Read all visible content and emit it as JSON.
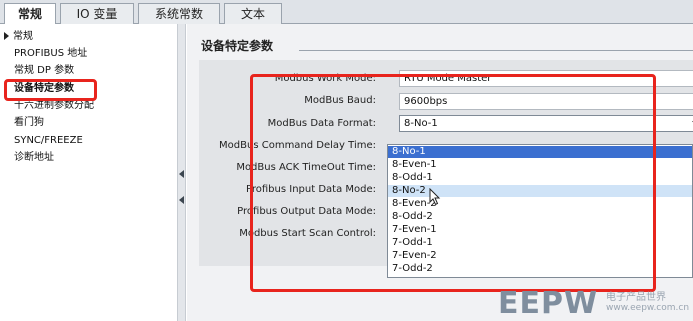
{
  "tabs": [
    {
      "label": "常规"
    },
    {
      "label": "IO 变量"
    },
    {
      "label": "系统常数"
    },
    {
      "label": "文本"
    }
  ],
  "nav": {
    "items": [
      {
        "label": "常规"
      },
      {
        "label": "PROFIBUS 地址"
      },
      {
        "label": "常规 DP 参数"
      },
      {
        "label": "设备特定参数"
      },
      {
        "label": "十六进制参数分配"
      },
      {
        "label": "看门狗"
      },
      {
        "label": "SYNC/FREEZE"
      },
      {
        "label": "诊断地址"
      }
    ]
  },
  "main": {
    "section_title": "设备特定参数",
    "fields": [
      {
        "label": "Modbus Work Mode:",
        "value": "RTU Mode Master"
      },
      {
        "label": "ModBus Baud:",
        "value": "9600bps"
      },
      {
        "label": "ModBus Data Format:",
        "value": "8-No-1"
      },
      {
        "label": "ModBus Command Delay Time:"
      },
      {
        "label": "ModBus ACK TimeOut Time:"
      },
      {
        "label": "Profibus Input Data Mode:"
      },
      {
        "label": "Profibus Output Data Mode:"
      },
      {
        "label": "Modbus Start Scan Control:"
      }
    ],
    "dropdown_options": [
      "8-No-1",
      "8-Even-1",
      "8-Odd-1",
      "8-No-2",
      "8-Even-2",
      "8-Odd-2",
      "7-Even-1",
      "7-Odd-1",
      "7-Even-2",
      "7-Odd-2"
    ],
    "selected_option": "8-No-1",
    "hovered_option": "8-No-2"
  },
  "watermark": {
    "logo": "EEPW",
    "subtitle": "电子产品世界",
    "url": "www.eepw.com.cn"
  },
  "colors": {
    "highlight_red": "#e8241d",
    "selection_blue": "#3b6fd0",
    "hover_blue": "#cfe3f7"
  }
}
